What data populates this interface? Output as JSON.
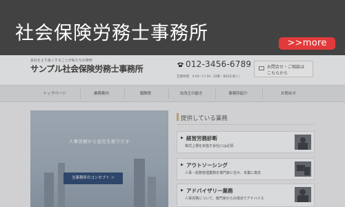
{
  "banner": {
    "title": "社会保険労務士事務所",
    "more_label": ">>more"
  },
  "site": {
    "tagline": "会社をより良くすることが私たちの使命",
    "company_name": "サンプル社会保険労務士事務所",
    "phone_icon": "phone-icon",
    "phone": "012-3456-6789",
    "hours": "営業時間　9:00~17:00（日曜・祝日を除く）",
    "contact_line1": "お問合せ・ご相談は",
    "contact_line2": "こちらから",
    "nav": [
      "トップページ",
      "業務案内",
      "報酬表",
      "法改正の動き",
      "事務所紹介",
      "お問合せ"
    ],
    "hero_text": "人事労務から会社を創りだす",
    "hero_button": "当事務所のコンセプト ＞",
    "services_heading": "提供している業務",
    "services": [
      {
        "title": "経営労務診断",
        "desc": "株式上場を目指す会社には必須"
      },
      {
        "title": "アウトソーシング",
        "desc": "人事・総務管理業務を専門家に任せ、本業に専念"
      },
      {
        "title": "アドバイザリー業務",
        "desc": "人事労務について、専門家からの視点でアドバイス"
      }
    ]
  },
  "colors": {
    "banner_bg": "#424242",
    "more_bg": "#e23a3a",
    "hero_button_bg": "#2f4a72"
  }
}
